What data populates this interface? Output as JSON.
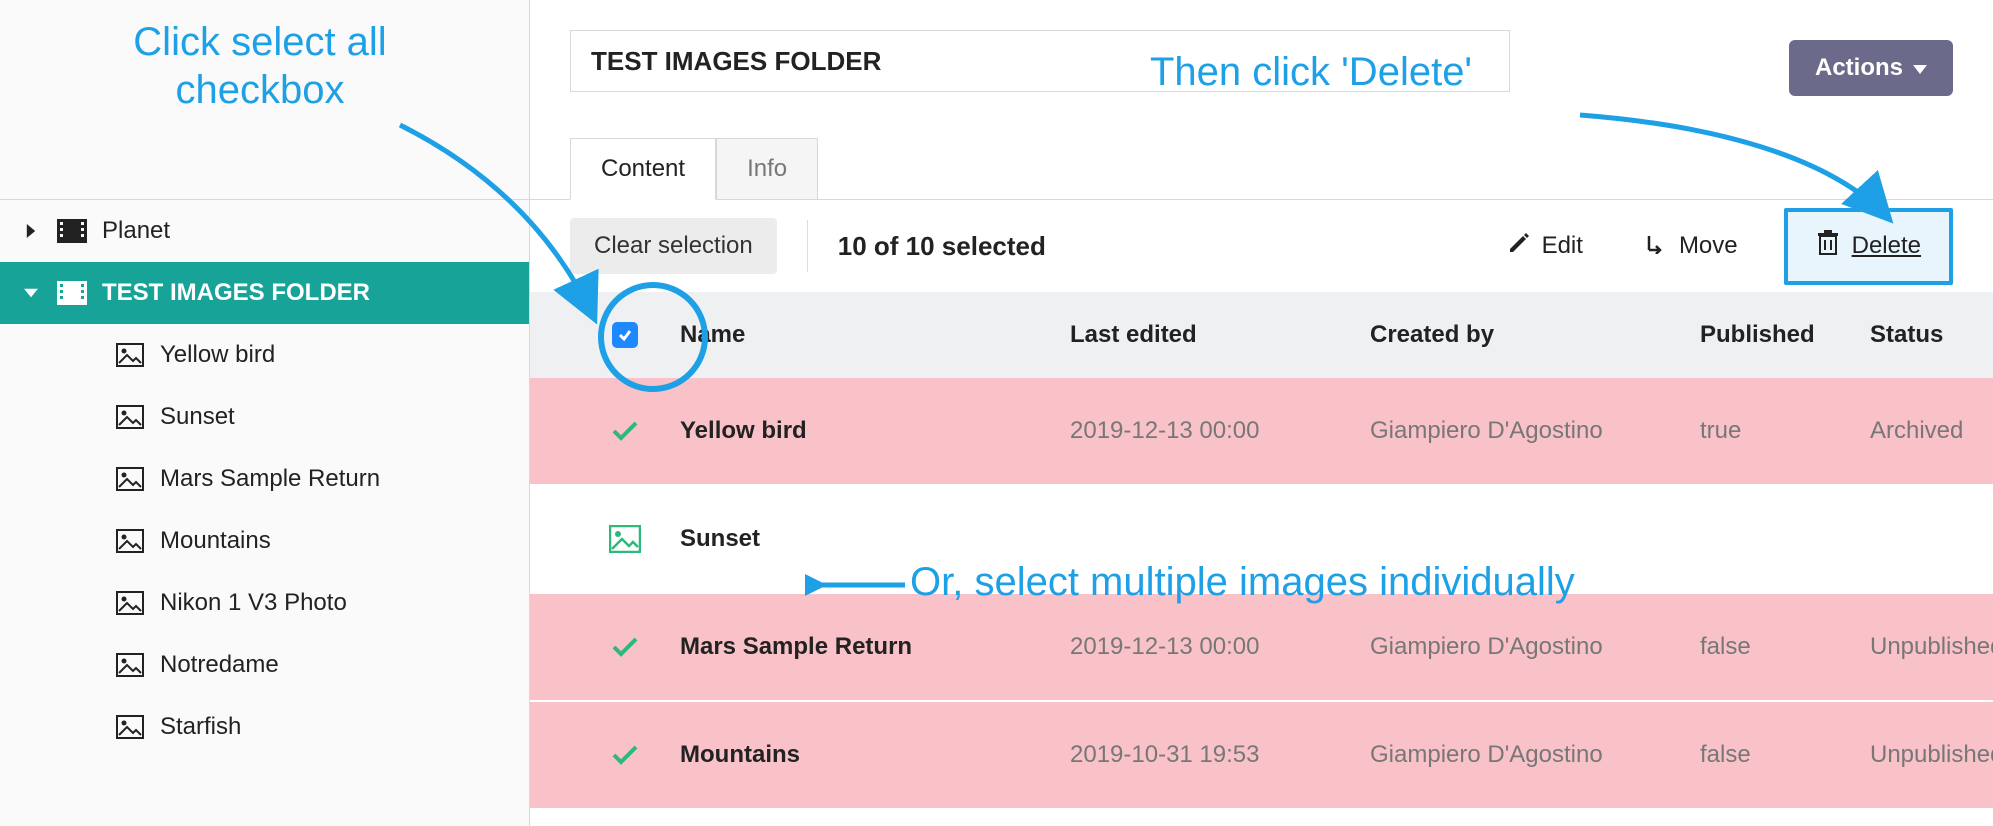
{
  "annotations": {
    "select_all": "Click select all\ncheckbox",
    "delete": "Then click 'Delete'",
    "individual": "Or, select multiple images individually"
  },
  "sidebar": {
    "tree": [
      {
        "label": "Planet",
        "type": "folder",
        "expanded": false,
        "selected": false
      },
      {
        "label": "TEST IMAGES FOLDER",
        "type": "folder",
        "expanded": true,
        "selected": true,
        "children": [
          {
            "label": "Yellow bird"
          },
          {
            "label": "Sunset"
          },
          {
            "label": "Mars Sample Return"
          },
          {
            "label": "Mountains"
          },
          {
            "label": "Nikon 1 V3 Photo"
          },
          {
            "label": "Notredame"
          },
          {
            "label": "Starfish"
          }
        ]
      }
    ]
  },
  "header": {
    "title_value": "TEST IMAGES FOLDER",
    "actions_label": "Actions"
  },
  "tabs": [
    {
      "label": "Content",
      "active": true
    },
    {
      "label": "Info",
      "active": false
    }
  ],
  "toolbar": {
    "clear_label": "Clear selection",
    "selection_text": "10 of 10 selected",
    "edit_label": "Edit",
    "move_label": "Move",
    "delete_label": "Delete"
  },
  "columns": {
    "name": "Name",
    "last_edited": "Last edited",
    "created_by": "Created by",
    "published": "Published",
    "status": "Status"
  },
  "rows": [
    {
      "selected": true,
      "name": "Yellow bird",
      "last_edited": "2019-12-13 00:00",
      "created_by": "Giampiero D'Agostino",
      "published": "true",
      "status": "Archived"
    },
    {
      "selected": false,
      "name": "Sunset",
      "last_edited": "",
      "created_by": "",
      "published": "",
      "status": ""
    },
    {
      "selected": true,
      "name": "Mars Sample Return",
      "last_edited": "2019-12-13 00:00",
      "created_by": "Giampiero D'Agostino",
      "published": "false",
      "status": "Unpublished"
    },
    {
      "selected": true,
      "name": "Mountains",
      "last_edited": "2019-10-31 19:53",
      "created_by": "Giampiero D'Agostino",
      "published": "false",
      "status": "Unpublished"
    }
  ]
}
